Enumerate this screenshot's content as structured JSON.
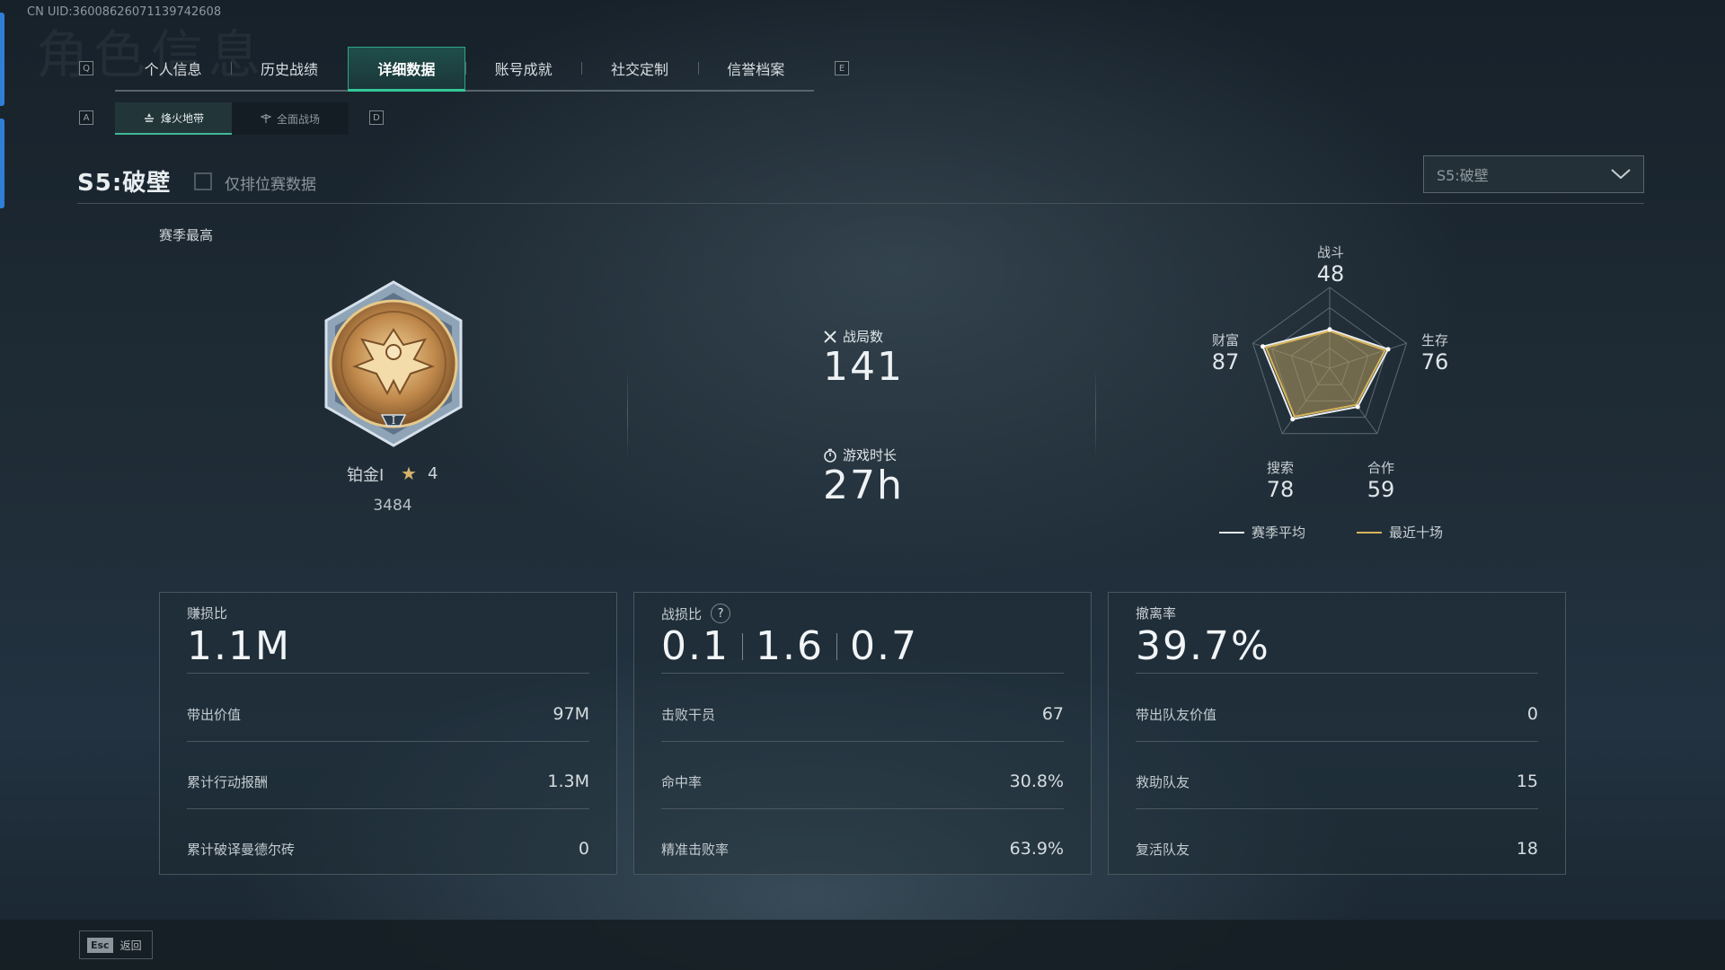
{
  "uid": "CN UID:36008626071139742608",
  "watermark": "角色信息",
  "keys": {
    "prev_tab": "Q",
    "next_tab": "E",
    "prev_sub": "A",
    "next_sub": "D"
  },
  "tabs": [
    "个人信息",
    "历史战绩",
    "详细数据",
    "账号成就",
    "社交定制",
    "信誉档案"
  ],
  "active_tab": "详细数据",
  "subtabs": [
    "烽火地带",
    "全面战场"
  ],
  "season": {
    "title": "S5:破壁",
    "ranked_only_label": "仅排位赛数据",
    "dropdown_value": "S5:破壁"
  },
  "rank": {
    "section_label": "赛季最高",
    "tier": "铂金I",
    "stars": "4",
    "score": "3484"
  },
  "summary": {
    "matches_label": "战局数",
    "matches_value": "141",
    "playtime_label": "游戏时长",
    "playtime_value": "27h"
  },
  "radar": {
    "axes": [
      {
        "label": "战斗",
        "value": "48"
      },
      {
        "label": "生存",
        "value": "76"
      },
      {
        "label": "合作",
        "value": "59"
      },
      {
        "label": "搜索",
        "value": "78"
      },
      {
        "label": "财富",
        "value": "87"
      }
    ],
    "season_avg": [
      48,
      76,
      59,
      78,
      87
    ],
    "recent_ten": [
      46,
      72,
      56,
      74,
      83
    ],
    "max": 100,
    "legend_season_avg": "赛季平均",
    "legend_recent": "最近十场",
    "colors": {
      "season_avg": "#e8edf0",
      "recent": "#d9b45a",
      "fill": "#b59a5e"
    }
  },
  "cards": [
    {
      "title": "赚损比",
      "big": "1.1M",
      "rows": [
        {
          "k": "带出价值",
          "v": "97M"
        },
        {
          "k": "累计行动报酬",
          "v": "1.3M"
        },
        {
          "k": "累计破译曼德尔砖",
          "v": "0"
        }
      ]
    },
    {
      "title": "战损比",
      "big_parts": [
        "0.1",
        "1.6",
        "0.7"
      ],
      "rows": [
        {
          "k": "击败干员",
          "v": "67"
        },
        {
          "k": "命中率",
          "v": "30.8%"
        },
        {
          "k": "精准击败率",
          "v": "63.9%"
        }
      ]
    },
    {
      "title": "撤离率",
      "big": "39.7%",
      "rows": [
        {
          "k": "带出队友价值",
          "v": "0"
        },
        {
          "k": "救助队友",
          "v": "15"
        },
        {
          "k": "复活队友",
          "v": "18"
        }
      ]
    }
  ],
  "footer": {
    "esc_key": "Esc",
    "back_label": "返回"
  }
}
